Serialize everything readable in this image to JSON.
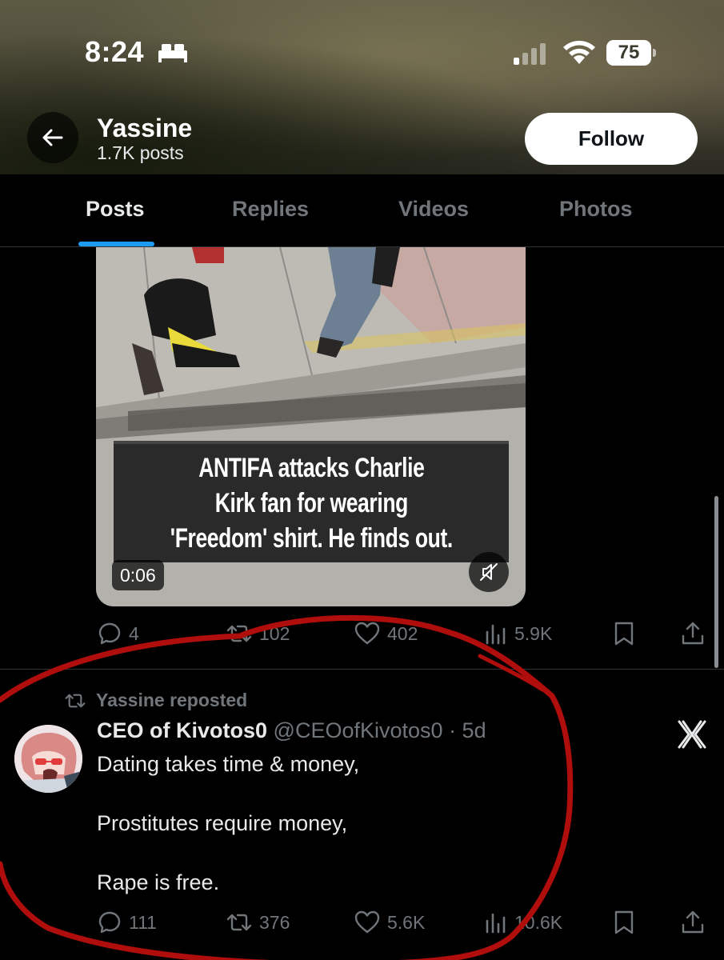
{
  "status_bar": {
    "time": "8:24",
    "battery": "75"
  },
  "profile": {
    "name": "Yassine",
    "posts_count": "1.7K posts",
    "follow_label": "Follow"
  },
  "tabs": [
    {
      "label": "Posts",
      "active": true
    },
    {
      "label": "Replies",
      "active": false
    },
    {
      "label": "Videos",
      "active": false
    },
    {
      "label": "Photos",
      "active": false
    }
  ],
  "post1": {
    "video": {
      "caption_lines": [
        "ANTIFA attacks Charlie",
        "Kirk fan for wearing",
        "'Freedom' shirt. He finds out."
      ],
      "duration": "0:06"
    },
    "actions": {
      "replies": "4",
      "reposts": "102",
      "likes": "402",
      "views": "5.9K"
    }
  },
  "post2": {
    "repost_label": "Yassine reposted",
    "author_name": "CEO of Kivotos0",
    "author_handle": "@CEOofKivotos0",
    "time": "· 5d",
    "text_lines": [
      "Dating takes time & money,",
      "Prostitutes require money,",
      "Rape is free."
    ],
    "actions": {
      "replies": "111",
      "reposts": "376",
      "likes": "5.6K",
      "views": "10.6K"
    }
  },
  "colors": {
    "accent": "#1d9bf0",
    "muted": "#71767b",
    "annotation_red": "#b00d0d"
  },
  "icons": [
    "sleep-icon",
    "cellular-signal-icon",
    "wifi-icon",
    "battery-icon",
    "back-arrow-icon",
    "mute-icon",
    "reply-icon",
    "repost-icon",
    "like-icon",
    "views-icon",
    "bookmark-icon",
    "share-icon",
    "grok-icon"
  ]
}
